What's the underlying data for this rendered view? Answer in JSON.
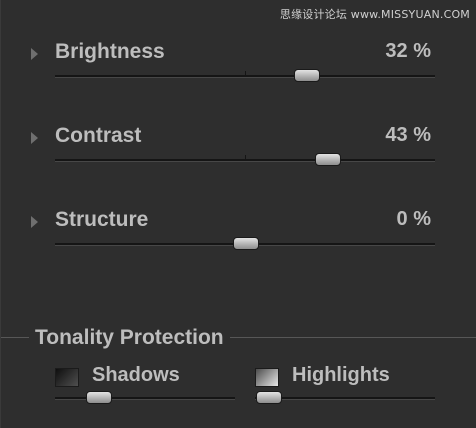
{
  "watermark": "思缘设计论坛 www.MISSYUAN.COM",
  "adjustments": [
    {
      "label": "Brightness",
      "value_text": "32 %",
      "value": 32,
      "min": -100,
      "max": 100
    },
    {
      "label": "Contrast",
      "value_text": "43 %",
      "value": 43,
      "min": -100,
      "max": 100
    },
    {
      "label": "Structure",
      "value_text": "0 %",
      "value": 0,
      "min": -100,
      "max": 100
    }
  ],
  "tonality": {
    "title": "Tonality Protection",
    "shadows": {
      "label": "Shadows",
      "checked": false,
      "slider_fraction": 0.24
    },
    "highlights": {
      "label": "Highlights",
      "checked": false,
      "slider_fraction": 0.07
    }
  },
  "colors": {
    "background": "#2e2e2e",
    "text": "#bdbdbd"
  }
}
